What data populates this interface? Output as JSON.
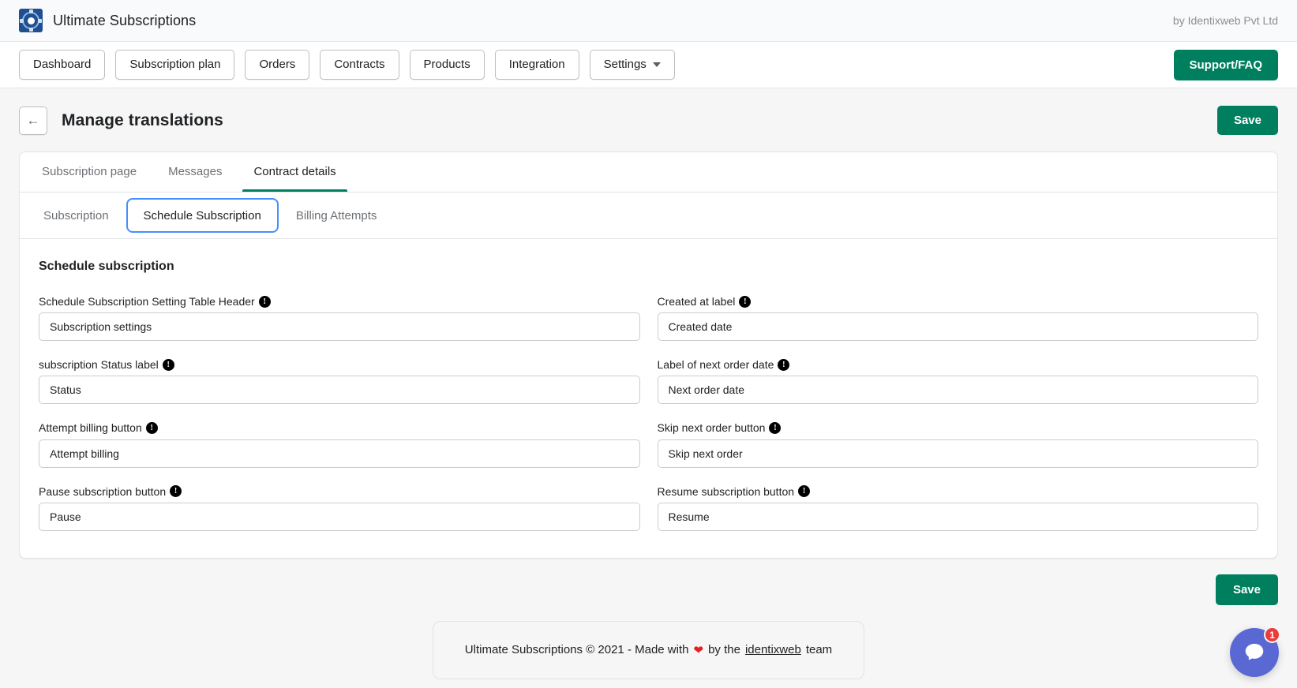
{
  "appbar": {
    "logo_icon": "subscription-logo-icon",
    "brand_name": "Ultimate Subscriptions",
    "by_line": "by Identixweb Pvt Ltd"
  },
  "nav": {
    "items": [
      {
        "label": "Dashboard",
        "has_caret": false
      },
      {
        "label": "Subscription plan",
        "has_caret": false
      },
      {
        "label": "Orders",
        "has_caret": false
      },
      {
        "label": "Contracts",
        "has_caret": false
      },
      {
        "label": "Products",
        "has_caret": false
      },
      {
        "label": "Integration",
        "has_caret": false
      },
      {
        "label": "Settings",
        "has_caret": true
      }
    ],
    "support_label": "Support/FAQ"
  },
  "page": {
    "back_icon": "arrow-left-icon",
    "back_glyph": "←",
    "title": "Manage translations",
    "save_top_label": "Save",
    "save_bottom_label": "Save"
  },
  "tabs": [
    {
      "label": "Subscription page",
      "active": false
    },
    {
      "label": "Messages",
      "active": false
    },
    {
      "label": "Contract details",
      "active": true
    }
  ],
  "subtabs": [
    {
      "label": "Subscription",
      "focused": false
    },
    {
      "label": "Schedule Subscription",
      "focused": true
    },
    {
      "label": "Billing Attempts",
      "focused": false
    }
  ],
  "section": {
    "title": "Schedule subscription",
    "info_glyph": "!",
    "fields": [
      {
        "label": "Schedule Subscription Setting Table Header",
        "value": "Subscription settings",
        "icon": "info-icon"
      },
      {
        "label": "Created at label",
        "value": "Created date",
        "icon": "info-icon"
      },
      {
        "label": "subscription Status label",
        "value": "Status",
        "icon": "info-icon"
      },
      {
        "label": "Label of next order date",
        "value": "Next order date",
        "icon": "info-icon"
      },
      {
        "label": "Attempt billing button",
        "value": "Attempt billing",
        "icon": "info-icon"
      },
      {
        "label": "Skip next order button",
        "value": "Skip next order",
        "icon": "info-icon"
      },
      {
        "label": "Pause subscription button",
        "value": "Pause",
        "icon": "info-icon"
      },
      {
        "label": "Resume subscription button",
        "value": "Resume",
        "icon": "info-icon"
      }
    ]
  },
  "credit": {
    "prefix": "Ultimate Subscriptions © 2021 - Made with",
    "heart": "❤",
    "middle": "by the",
    "link": "identixweb",
    "suffix": "team"
  },
  "chat": {
    "icon": "chat-bubble-icon",
    "badge_count": "1"
  },
  "colors": {
    "brand_green": "#007f5f",
    "tab_underline": "#008060",
    "focus_blue": "#458fff",
    "chat_blue": "#5a68d4",
    "badge_red": "#ec3b3b",
    "heart_red": "#e3211e",
    "logo_blue": "#1f4f91"
  }
}
